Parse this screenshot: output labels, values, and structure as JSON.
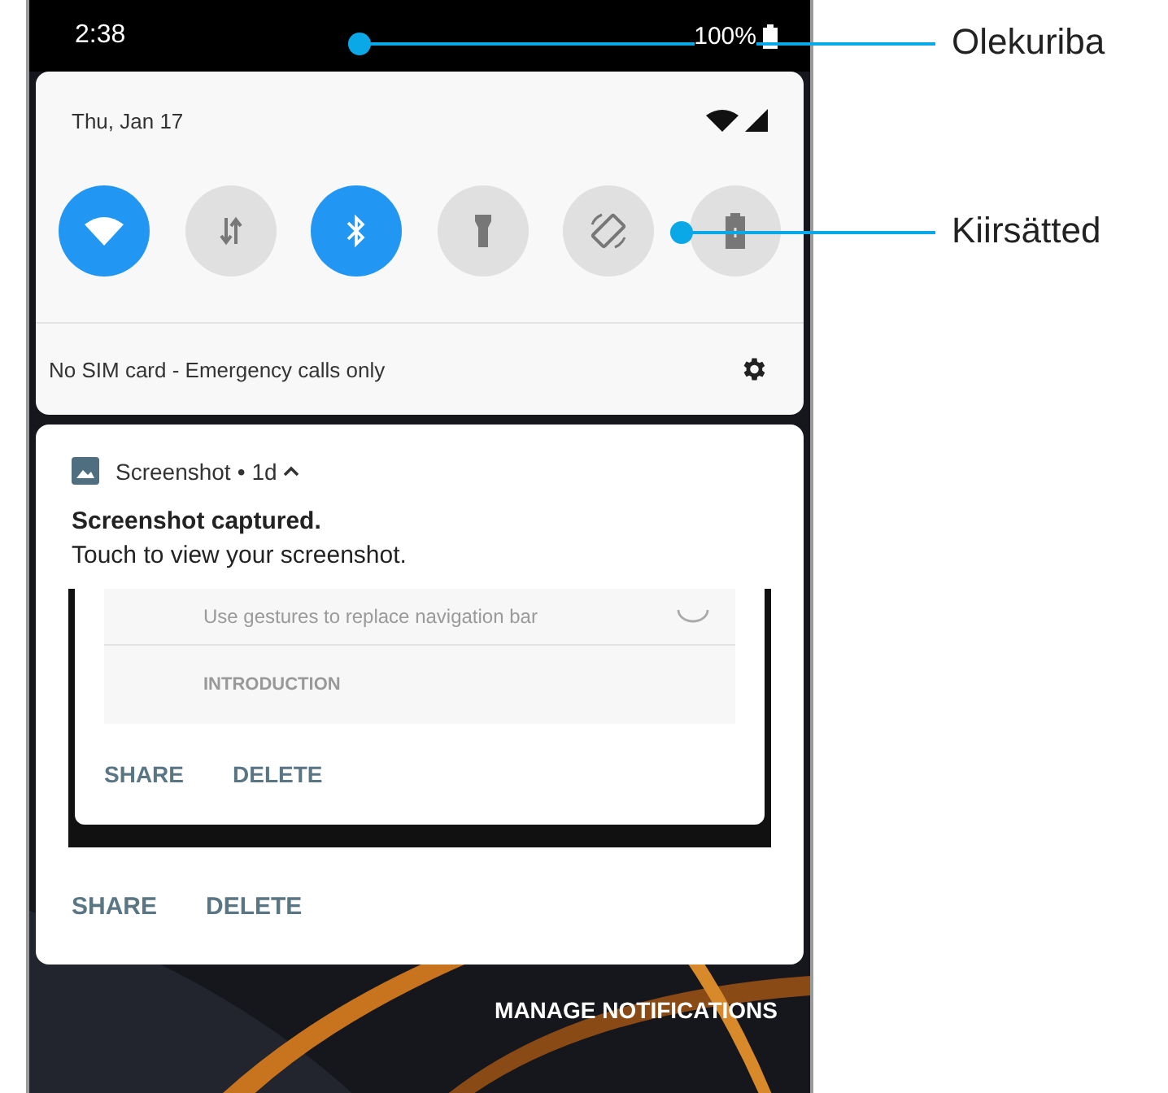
{
  "status_bar": {
    "time": "2:38",
    "battery": "100%"
  },
  "quick_settings": {
    "date": "Thu, Jan 17",
    "tiles": [
      {
        "kind": "wifi",
        "on": true
      },
      {
        "kind": "data",
        "on": false
      },
      {
        "kind": "bluetooth",
        "on": true
      },
      {
        "kind": "flashlight",
        "on": false
      },
      {
        "kind": "rotate",
        "on": false
      },
      {
        "kind": "battery",
        "on": false
      }
    ],
    "carrier": "No SIM card - Emergency calls only"
  },
  "notification": {
    "app": "Screenshot",
    "separator": "•",
    "age": "1d",
    "expanded": true,
    "title": "Screenshot captured.",
    "text": "Touch to view your screenshot.",
    "preview": {
      "setting_text": "Use gestures to replace navigation bar",
      "section": "INTRODUCTION",
      "actions": [
        "SHARE",
        "DELETE"
      ]
    },
    "actions": [
      "SHARE",
      "DELETE"
    ]
  },
  "manage_button": "MANAGE NOTIFICATIONS",
  "annotations": [
    {
      "label": "Olekuriba"
    },
    {
      "label": "Kiirsätted"
    }
  ]
}
